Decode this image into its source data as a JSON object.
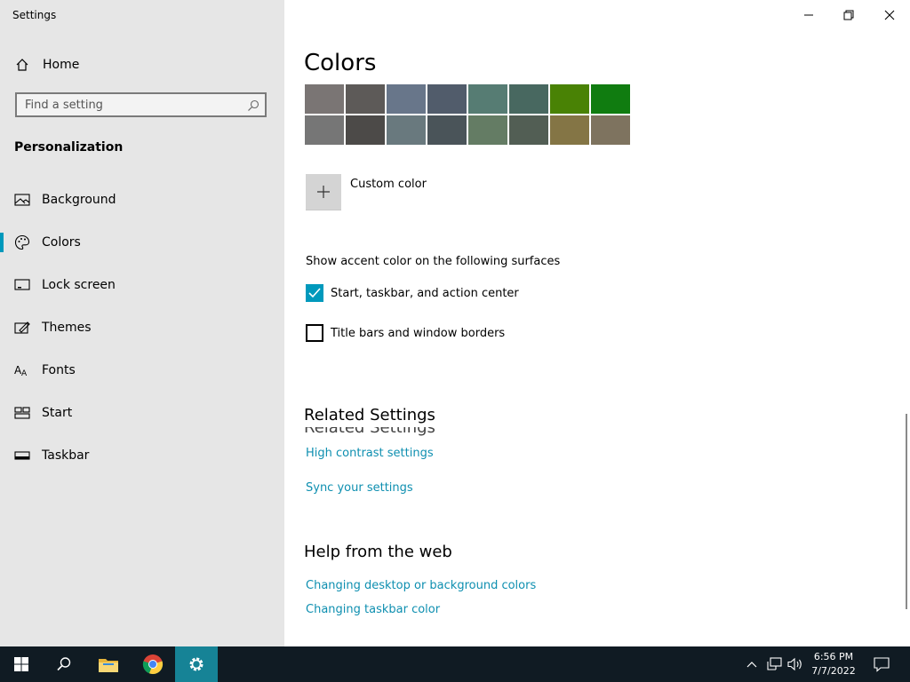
{
  "window": {
    "title": "Settings",
    "controls": [
      "minimize",
      "restore",
      "close"
    ]
  },
  "sidebar": {
    "home_label": "Home",
    "search": {
      "placeholder": "Find a setting",
      "value": ""
    },
    "section_title": "Personalization",
    "items": [
      {
        "label": "Background",
        "icon": "picture-icon"
      },
      {
        "label": "Colors",
        "icon": "palette-icon",
        "selected": true
      },
      {
        "label": "Lock screen",
        "icon": "lock-screen-icon"
      },
      {
        "label": "Themes",
        "icon": "themes-icon"
      },
      {
        "label": "Fonts",
        "icon": "fonts-icon"
      },
      {
        "label": "Start",
        "icon": "start-icon"
      },
      {
        "label": "Taskbar",
        "icon": "taskbar-icon"
      }
    ]
  },
  "main": {
    "title": "Colors",
    "swatches": [
      [
        "#7a7574",
        "#5d5a58",
        "#68768a",
        "#515c6b",
        "#567c73",
        "#486860",
        "#498205",
        "#107c10"
      ],
      [
        "#767676",
        "#4c4a48",
        "#69797e",
        "#4a5459",
        "#647c64",
        "#525e54",
        "#847545",
        "#7e735f"
      ]
    ],
    "custom_color_label": "Custom color",
    "surfaces_label": "Show accent color on the following surfaces",
    "checkboxes": [
      {
        "label": "Start, taskbar, and action center",
        "checked": true
      },
      {
        "label": "Title bars and window borders",
        "checked": false
      }
    ],
    "related": {
      "title": "Related Settings",
      "ghost_title": "Related Settings",
      "links": [
        "High contrast settings",
        "Sync your settings"
      ]
    },
    "help": {
      "title": "Help from the web",
      "links": [
        "Changing desktop or background colors",
        "Changing taskbar color"
      ]
    }
  },
  "taskbar": {
    "apps": [
      "start-icon",
      "search-icon",
      "file-explorer-icon",
      "chrome-icon",
      "settings-icon"
    ],
    "active_app": "settings-icon",
    "clock": {
      "time": "6:56 PM",
      "date": "7/7/2022"
    }
  },
  "colors": {
    "accent": "#0099bc",
    "link": "#0e8fb0",
    "sidebar_bg": "#e6e6e6",
    "taskbar_bg": "#101b23",
    "taskbar_active": "#168396"
  }
}
